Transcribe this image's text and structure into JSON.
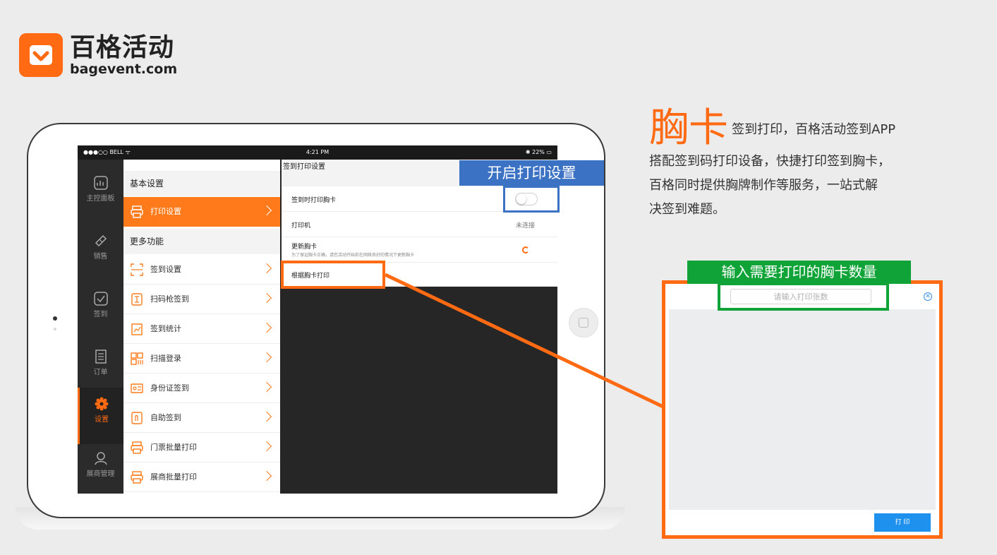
{
  "logo": {
    "brand_cn": "百格活动",
    "brand_en": "bagevent.com"
  },
  "status_bar": {
    "carrier": "●●●○○ BELL ᯤ",
    "time": "4:21 PM",
    "battery": "✱ 22% ▭"
  },
  "nav": [
    {
      "label": "主控面板",
      "icon": "dashboard-icon"
    },
    {
      "label": "销售",
      "icon": "ticket-icon"
    },
    {
      "label": "签到",
      "icon": "checkin-icon"
    },
    {
      "label": "订单",
      "icon": "order-icon"
    },
    {
      "label": "设置",
      "icon": "gear-icon",
      "active": true
    },
    {
      "label": "展商管理",
      "icon": "person-icon"
    }
  ],
  "menu": {
    "section_basic": "基本设置",
    "print_settings": "打印设置",
    "section_more": "更多功能",
    "items": [
      {
        "label": "签到设置",
        "icon": "scan-frame-icon"
      },
      {
        "label": "扫码枪签到",
        "icon": "scanner-gun-icon"
      },
      {
        "label": "签到统计",
        "icon": "stats-icon"
      },
      {
        "label": "扫描登录",
        "icon": "qr-code-icon"
      },
      {
        "label": "身份证签到",
        "icon": "id-card-icon"
      },
      {
        "label": "自助签到",
        "icon": "self-service-icon"
      },
      {
        "label": "门票批量打印",
        "icon": "printer-icon"
      },
      {
        "label": "展商批量打印",
        "icon": "printer-icon"
      }
    ]
  },
  "detail": {
    "header": "签到打印设置",
    "print_on_checkin": "签到时打印胸卡",
    "printer_label": "打印机",
    "printer_status": "未连接",
    "update_badge_title": "更新胸卡",
    "update_badge_sub": "为了保证胸卡正确，请您活动开始前在网络良好的情况下更新胸卡",
    "print_by_badge": "根据胸卡打印"
  },
  "callouts": {
    "enable_print": "开启打印设置",
    "input_count": "输入需要打印的胸卡数量"
  },
  "headline": {
    "big": "胸卡",
    "intro": "签到打印，百格活动签到APP",
    "body_lines": [
      "搭配签到码打印设备，快捷打印签到胸卡，",
      "百格同时提供胸牌制作等服务，一站式解",
      "决签到难题。"
    ]
  },
  "dialog": {
    "placeholder": "请输入打印张数",
    "close": "✕",
    "print_button": "打 印"
  },
  "colors": {
    "accent": "#ff6a13",
    "blue": "#3c72c4",
    "green": "#10a337",
    "button_blue": "#1e90ee"
  }
}
